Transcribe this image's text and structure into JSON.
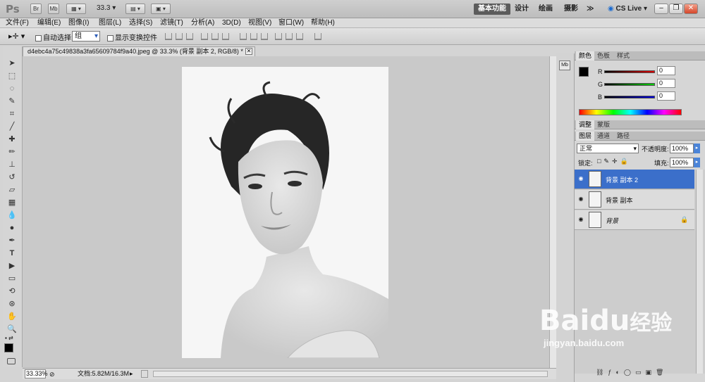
{
  "app": {
    "logo": "Ps",
    "br": "Br",
    "mb": "Mb",
    "zoom_menu": "33.3",
    "workspaces": [
      "基本功能",
      "设计",
      "绘画",
      "摄影"
    ],
    "more": "≫",
    "cs_live": "CS Live"
  },
  "menu": [
    "文件(F)",
    "编辑(E)",
    "图像(I)",
    "图层(L)",
    "选择(S)",
    "滤镜(T)",
    "分析(A)",
    "3D(D)",
    "视图(V)",
    "窗口(W)",
    "帮助(H)"
  ],
  "options": {
    "auto_select_label": "自动选择:",
    "auto_select_value": "组",
    "show_transform_label": "显示变换控件"
  },
  "document": {
    "tab_title": "d4ebc4a75c49838a3fa65609784f9a40.jpeg @ 33.3% (背景 副本 2, RGB/8) *"
  },
  "status": {
    "zoom": "33.33%",
    "doc_size": "文档:5.82M/16.3M"
  },
  "color_panel": {
    "tabs": [
      "颜色",
      "色板",
      "样式"
    ],
    "channels": [
      {
        "label": "R",
        "value": "0",
        "color": "#d40000"
      },
      {
        "label": "G",
        "value": "0",
        "color": "#00b000"
      },
      {
        "label": "B",
        "value": "0",
        "color": "#0000c8"
      }
    ]
  },
  "adjust_tabs": [
    "调整",
    "蒙版"
  ],
  "layers_panel": {
    "tabs": [
      "图层",
      "通道",
      "路径"
    ],
    "blend_mode": "正常",
    "opacity_label": "不透明度:",
    "opacity": "100%",
    "lock_label": "锁定:",
    "fill_label": "填充:",
    "fill": "100%",
    "layers": [
      {
        "name": "背景 副本 2",
        "selected": true
      },
      {
        "name": "背景 副本",
        "selected": false
      },
      {
        "name": "背景",
        "selected": false,
        "locked": true
      }
    ]
  },
  "watermark": {
    "brand": "Baidu",
    "brand_cn": "经验",
    "url": "jingyan.baidu.com"
  },
  "colors": {
    "selection": "#3b6fca"
  }
}
